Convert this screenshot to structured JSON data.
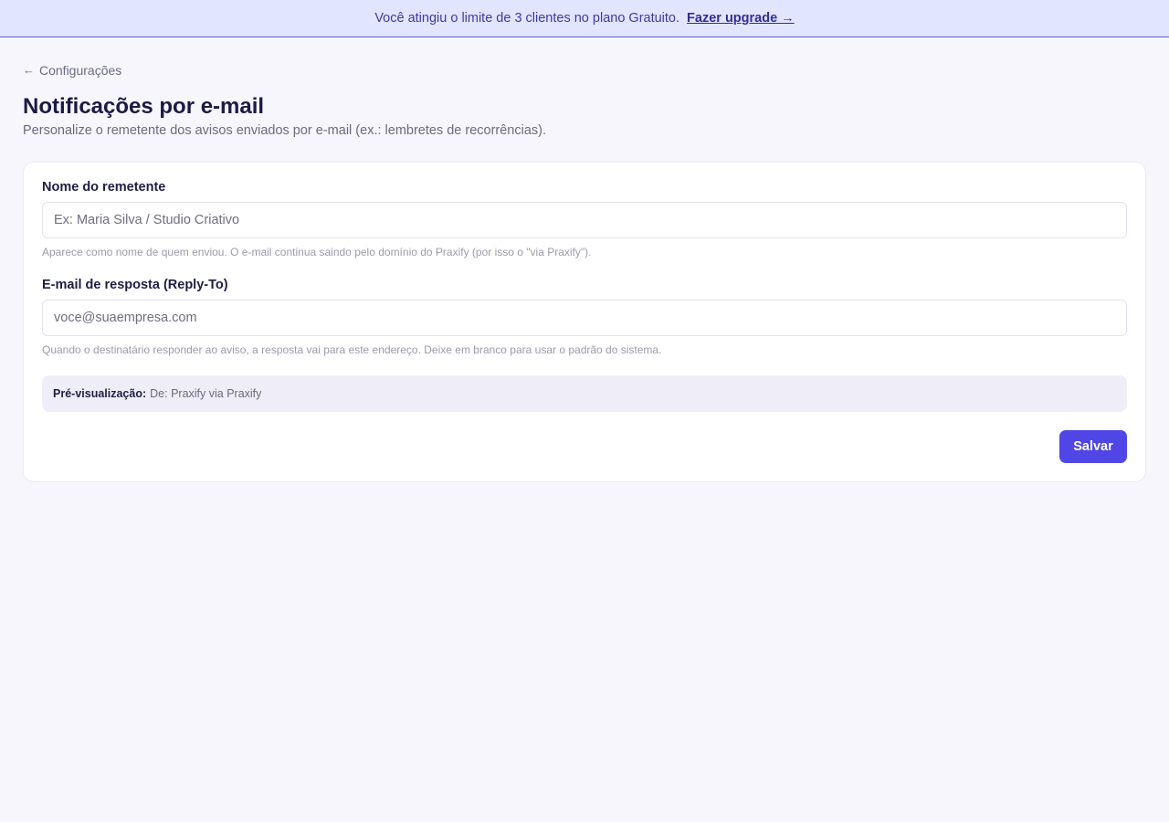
{
  "banner": {
    "message": "Você atingiu o limite de 3 clientes no plano Gratuito.",
    "upgrade_link": "Fazer upgrade →"
  },
  "breadcrumb": {
    "icon": "arrow-left-icon",
    "label": "Configurações"
  },
  "page": {
    "title": "Notificações por e-mail",
    "subtitle": "Personalize o remetente dos avisos enviados por e-mail (ex.: lembretes de recorrências)."
  },
  "form": {
    "sender_name": {
      "label": "Nome do remetente",
      "value": "",
      "placeholder": "Ex: Maria Silva / Studio Criativo",
      "hint": "Aparece como nome de quem enviou. O e-mail continua saindo pelo domínio do Praxify (por isso o \"via Praxify\")."
    },
    "reply_to": {
      "label": "E-mail de resposta (Reply-To)",
      "value": "",
      "placeholder": "voce@suaempresa.com",
      "hint": "Quando o destinatário responder ao aviso, a resposta vai para este endereço. Deixe em branco para usar o padrão do sistema."
    },
    "preview": {
      "label": "Pré-visualização:",
      "value": "De: Praxify via Praxify"
    },
    "save_label": "Salvar"
  },
  "colors": {
    "accent": "#4f46e5",
    "banner_bg": "#e1e5fd",
    "page_bg": "#f7f6fd"
  }
}
